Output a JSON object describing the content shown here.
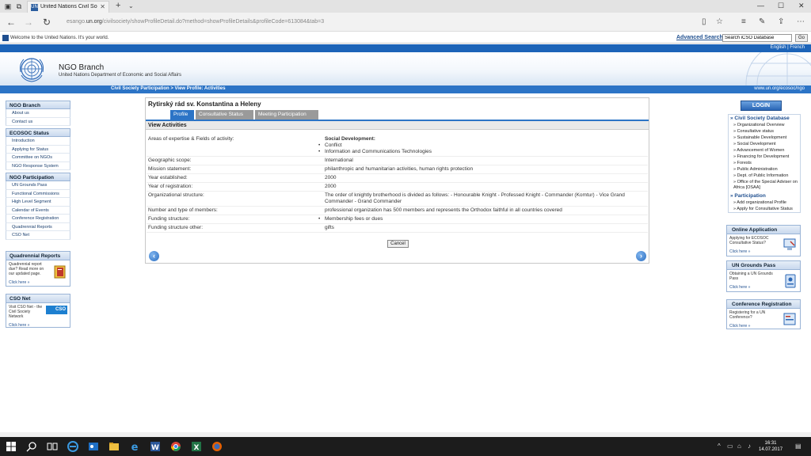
{
  "browser": {
    "tab_title": "United Nations Civil Soc",
    "tab_favicon_text": "UN",
    "url_prefix": "esango.",
    "url_domain": "un.org",
    "url_path": "/civilsociety/showProfileDetail.do?method=showProfileDetails&profileCode=613084&tab=3"
  },
  "ie_toolbar": {
    "welcome": "Welcome to the United Nations. It's your world.",
    "advanced_search": "Advanced Search",
    "search_value": "Search iCSO Database",
    "go": "Go"
  },
  "header": {
    "languages": "English | French",
    "org_name": "NGO Branch",
    "department": "United Nations Department of Economic and Social Affairs",
    "breadcrumb": "Civil Society Participation > View Profile: Activities",
    "site_url": "www.un.org/ecosoc/ngo"
  },
  "left_nav": {
    "sections": [
      {
        "title": "NGO Branch",
        "items": [
          "About us",
          "Contact us"
        ]
      },
      {
        "title": "ECOSOC Status",
        "items": [
          "Introduction",
          "Applying for Status",
          "Committee on NGOs",
          "NGO Response System"
        ]
      },
      {
        "title": "NGO Participation",
        "items": [
          "UN Grounds Pass",
          "Functional Commissions",
          "High Level Segment",
          "Calendar of Events",
          "Conference Registration",
          "Quadrennial Reports",
          "CSO Net"
        ]
      }
    ],
    "boxes": [
      {
        "title": "Quadrennial Reports",
        "text": "Quadrennial report due? Read more on our updated page.",
        "link": "Click here »"
      },
      {
        "title": "CSO Net",
        "text": "Visit CSO Net - the Civil Society Network",
        "link": "Click here »",
        "badge": "CSO"
      }
    ]
  },
  "profile": {
    "name": "Rytirský rád sv. Konstantina a Heleny",
    "tabs": [
      "Profile",
      "Consultative Status",
      "Meeting Participation"
    ],
    "section_title": "View Activities",
    "rows": [
      {
        "label": "Areas of expertise & Fields of activity:",
        "heading": "Social Development:",
        "bullets": [
          "Conflict",
          "Information and Communications Technologies"
        ]
      },
      {
        "label": "Geographic scope:",
        "value": "International"
      },
      {
        "label": "Mission statement:",
        "value": "philanthropic and humanitarian activities, human rights protection"
      },
      {
        "label": "Year established:",
        "value": "2000"
      },
      {
        "label": "Year of registration:",
        "value": "2000"
      },
      {
        "label": "Organizational structure:",
        "value": "The order of knightly brotherhood is divided as follows: - Honourable Knight - Professed Knight - Commander (Komtur) - Vice Grand Commander - Grand Commander"
      },
      {
        "label": "Number and type of members:",
        "value": "professional organization has 500 members and represents the Orthodox faithful in all countries covered"
      },
      {
        "label": "Funding structure:",
        "bullets": [
          "Membership fees or dues"
        ]
      },
      {
        "label": "Funding structure other:",
        "value": "gifts"
      }
    ],
    "cancel": "Cancel"
  },
  "right_nav": {
    "login": "LOGIN",
    "db_title": "» Civil Society Database",
    "db_items": [
      "» Organizational Overview",
      "» Consultative status",
      "» Sustainable Development",
      "» Social Development",
      "» Advancement of Women",
      "» Financing for Development",
      "» Forests",
      "» Public Administration",
      "» Dept. of Public Information",
      "» Office of the Special Adviser on Africa [OSAA]"
    ],
    "part_title": "» Participation",
    "part_items": [
      "» Add organizational Profile",
      "» Apply for Consultative Status"
    ],
    "boxes": [
      {
        "title": "Online Application",
        "text": "Applying for ECOSOC Consultative Status?",
        "link": "Click here »"
      },
      {
        "title": "UN Grounds Pass",
        "text": "Obtaining a UN Grounds Pass",
        "link": "Click here »"
      },
      {
        "title": "Conference Registration",
        "text": "Registering for a UN Conference?",
        "link": "Click here »"
      }
    ]
  },
  "taskbar": {
    "time": "16:31",
    "date": "14.07.2017"
  },
  "colors": {
    "brand_blue": "#2c74c6",
    "header_blue": "#1d64b8",
    "tab_inactive": "#9a9a9a"
  }
}
